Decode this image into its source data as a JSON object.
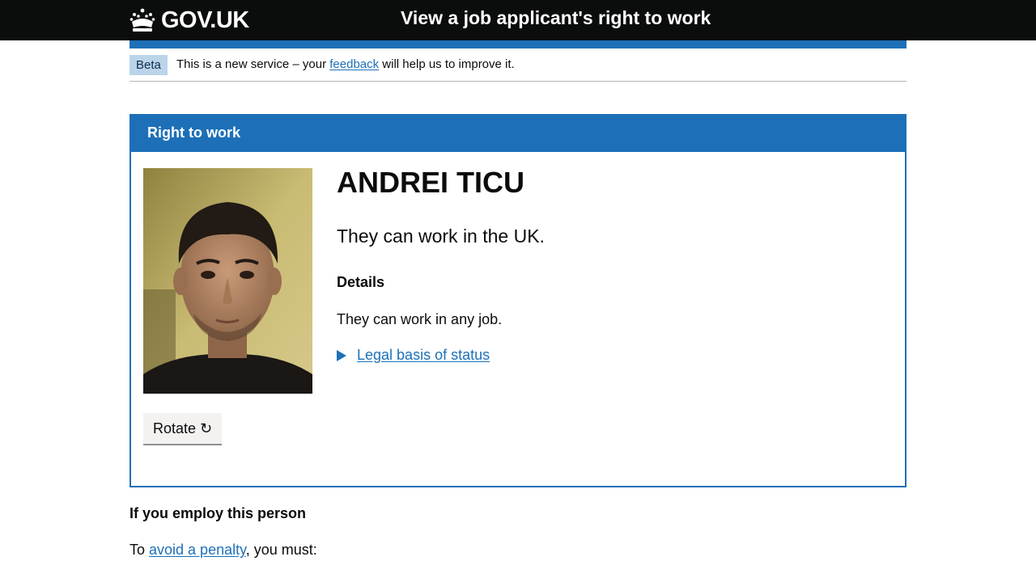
{
  "header": {
    "logo_text": "GOV.UK",
    "logo_icon": "crown-icon",
    "service_name": "View a job applicant's right to work"
  },
  "phase_banner": {
    "tag": "Beta",
    "text_before": "This is a new service – your ",
    "link_text": "feedback",
    "text_after": " will help us to improve it."
  },
  "panel": {
    "title": "Right to work",
    "name": "ANDREI TICU",
    "status": "They can work in the UK.",
    "details_heading": "Details",
    "details_text": "They can work in any job.",
    "legal_basis_label": "Legal basis of status",
    "rotate_label": "Rotate ↻"
  },
  "employ": {
    "heading": "If you employ this person",
    "text_before": "To ",
    "link_text": "avoid a penalty",
    "text_after": ", you must:"
  },
  "colors": {
    "header_bg": "#0b0c0c",
    "brand_blue": "#1d70b8",
    "tag_bg": "#bbd4ea",
    "button_bg": "#f3f2f1"
  }
}
